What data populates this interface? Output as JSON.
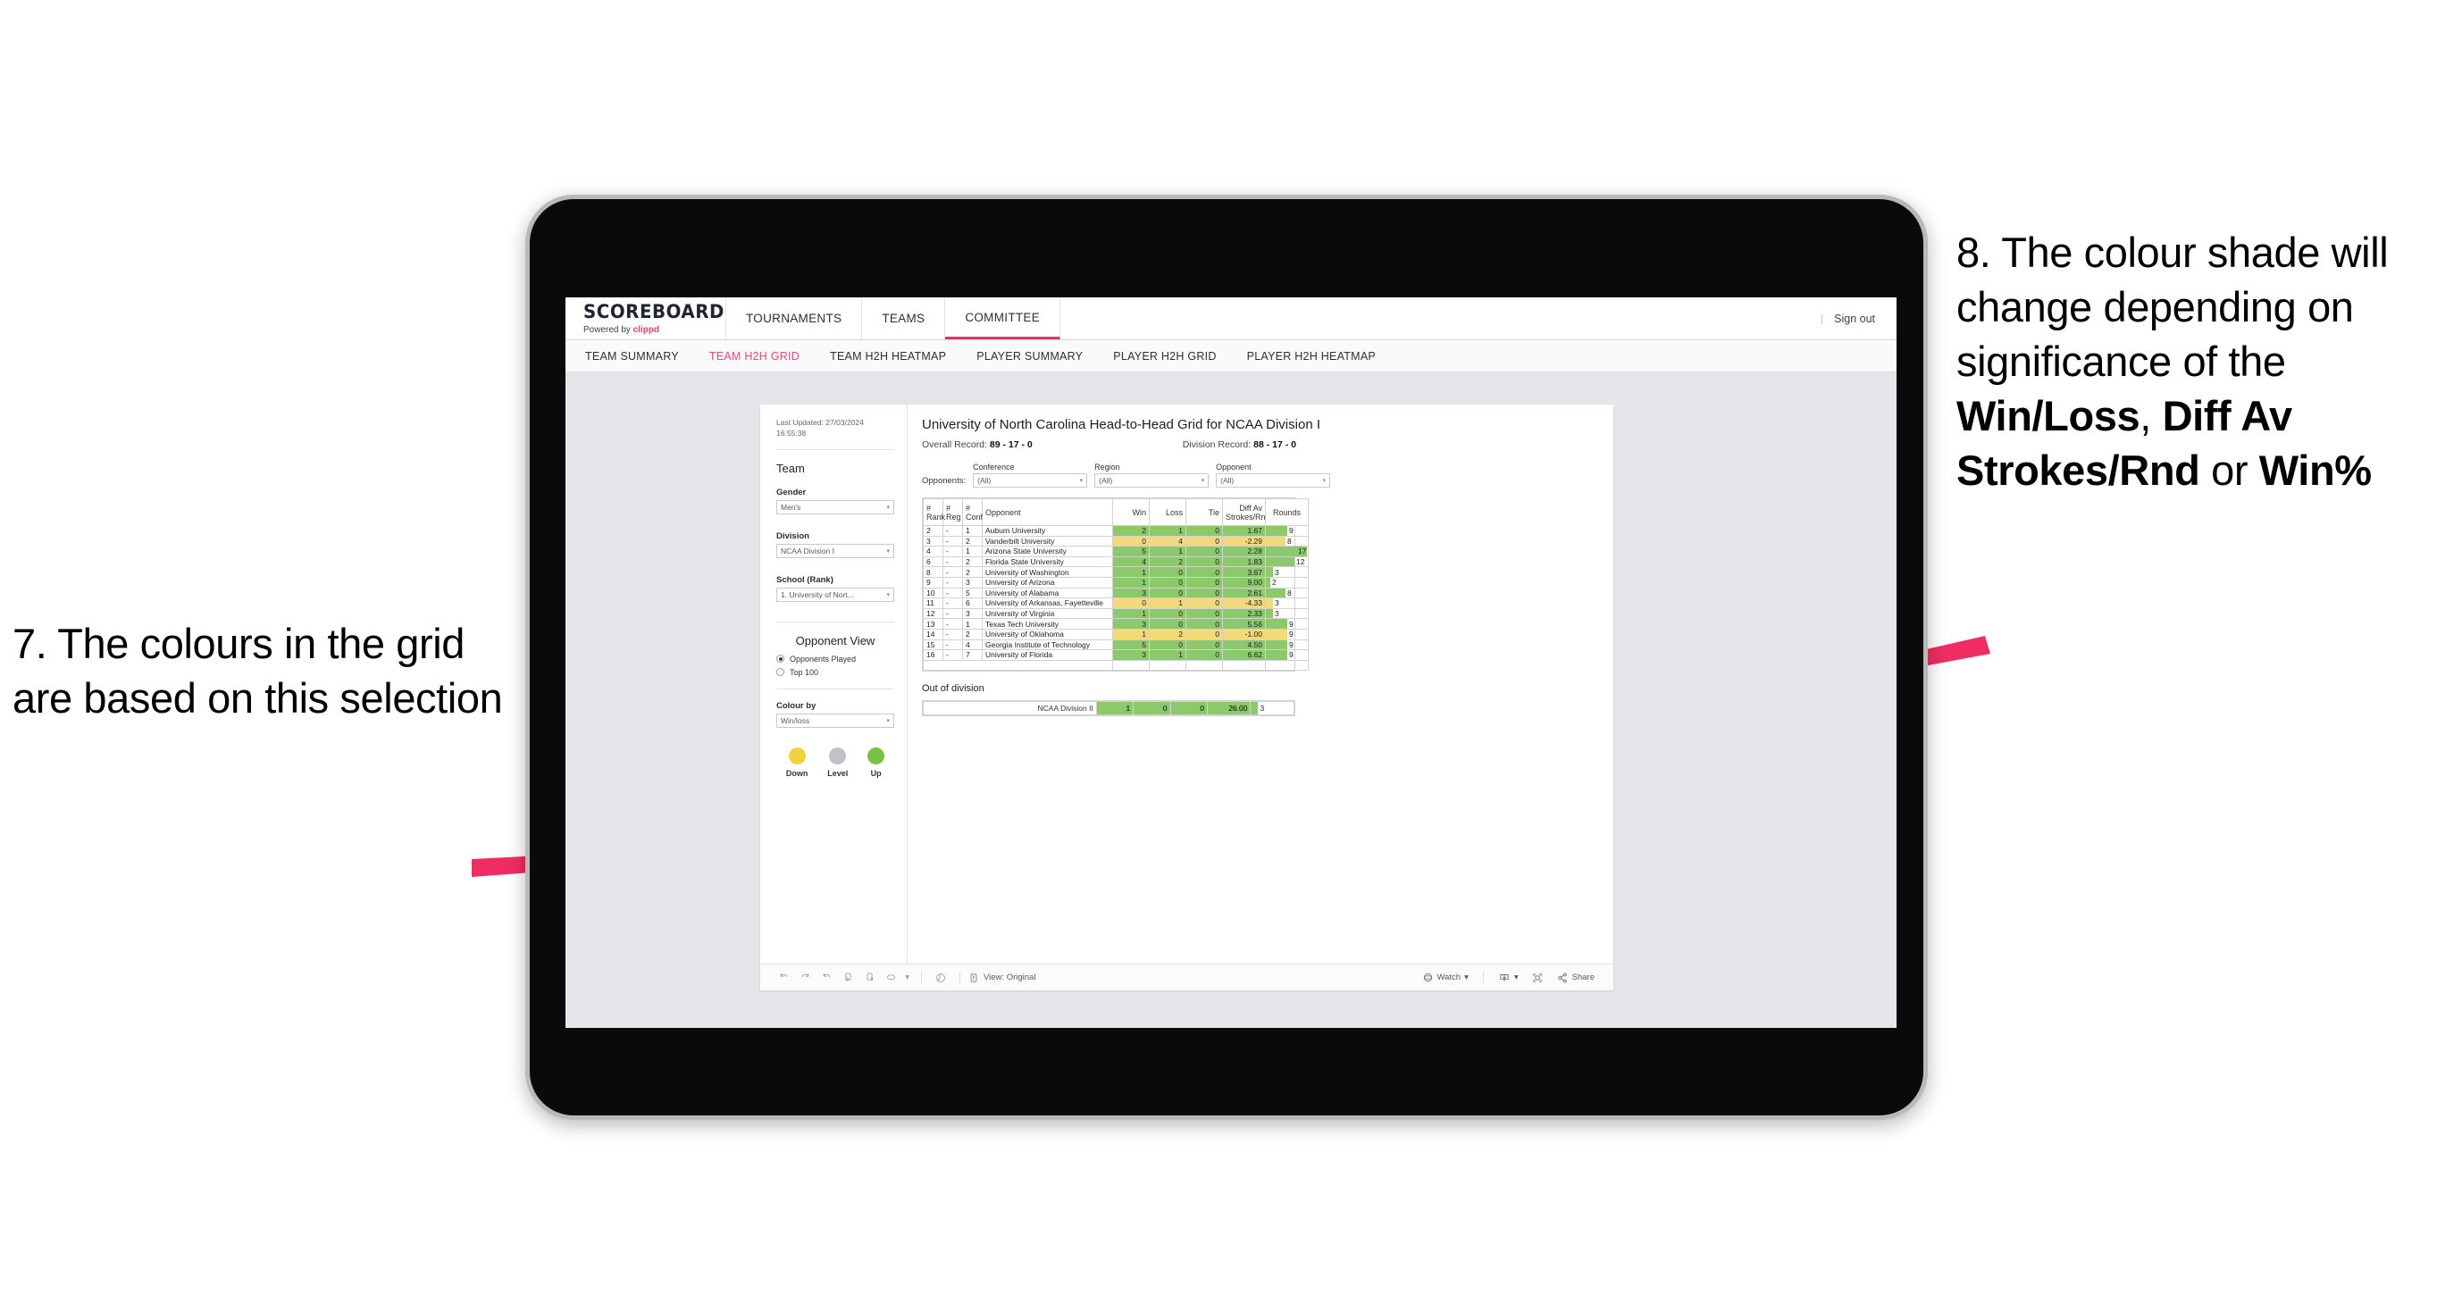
{
  "annotations": {
    "left": {
      "number": "7.",
      "text": "7. The colours in the grid are based on this selection"
    },
    "right": {
      "prefix": "8. The colour shade will change depending on significance of the ",
      "bold1": "Win/Loss",
      "mid1": ", ",
      "bold2": "Diff Av Strokes/Rnd",
      "mid2": " or ",
      "bold3": "Win%"
    },
    "arrow_color": "#ef2d62"
  },
  "app": {
    "brand": {
      "title": "SCOREBOARD",
      "powered_prefix": "Powered by ",
      "powered_brand": "clippd"
    },
    "topnav": [
      {
        "label": "TOURNAMENTS",
        "active": false
      },
      {
        "label": "TEAMS",
        "active": false
      },
      {
        "label": "COMMITTEE",
        "active": true
      }
    ],
    "signout": "Sign out",
    "divider": "|",
    "subnav": [
      {
        "label": "TEAM SUMMARY",
        "active": false
      },
      {
        "label": "TEAM H2H GRID",
        "active": true
      },
      {
        "label": "TEAM H2H HEATMAP",
        "active": false
      },
      {
        "label": "PLAYER SUMMARY",
        "active": false
      },
      {
        "label": "PLAYER H2H GRID",
        "active": false
      },
      {
        "label": "PLAYER H2H HEATMAP",
        "active": false
      }
    ],
    "accent_pink": "#e8477a"
  },
  "filters": {
    "last_updated": "Last Updated: 27/03/2024 16:55:38",
    "team_heading": "Team",
    "gender_label": "Gender",
    "gender_value": "Men's",
    "division_label": "Division",
    "division_value": "NCAA Division I",
    "school_label": "School (Rank)",
    "school_value": "1. University of Nort...",
    "opponent_view_heading": "Opponent View",
    "opponent_view_options": [
      {
        "label": "Opponents Played",
        "selected": true
      },
      {
        "label": "Top 100",
        "selected": false
      }
    ],
    "colour_by_label": "Colour by",
    "colour_by_value": "Win/loss",
    "legend": [
      {
        "label": "Down",
        "color": "#f2d13f"
      },
      {
        "label": "Level",
        "color": "#bfc1c4"
      },
      {
        "label": "Up",
        "color": "#7ac143"
      }
    ]
  },
  "viz": {
    "title": "University of North Carolina Head-to-Head Grid for NCAA Division I",
    "overall_record_label": "Overall Record: ",
    "overall_record_value": "89 - 17 - 0",
    "division_record_label": "Division Record: ",
    "division_record_value": "88 - 17 - 0",
    "opponents_label": "Opponents:",
    "opponent_filters": [
      {
        "label": "Conference",
        "value": "(All)"
      },
      {
        "label": "Region",
        "value": "(All)"
      },
      {
        "label": "Opponent",
        "value": "(All)"
      }
    ],
    "out_of_division_title": "Out of division"
  },
  "chart_data": {
    "type": "table",
    "title": "University of North Carolina Head-to-Head Grid for NCAA Division I",
    "columns": [
      "# Rank",
      "# Reg",
      "# Conf",
      "Opponent",
      "Win",
      "Loss",
      "Tie",
      "Diff Av Strokes/Rnd",
      "Rounds"
    ],
    "rounds_max": 17,
    "colors": {
      "up": "#8cc96a",
      "down": "#f2d97a",
      "level": "#bfc1c4"
    },
    "rows": [
      {
        "rank": "2",
        "reg": "-",
        "conf": "1",
        "opponent": "Auburn University",
        "win": "2",
        "loss": "1",
        "tie": "0",
        "diff": "1.67",
        "rounds": "9",
        "rounds_n": 9,
        "shade": "up"
      },
      {
        "rank": "3",
        "reg": "-",
        "conf": "2",
        "opponent": "Vanderbilt University",
        "win": "0",
        "loss": "4",
        "tie": "0",
        "diff": "-2.29",
        "rounds": "8",
        "rounds_n": 8,
        "shade": "down"
      },
      {
        "rank": "4",
        "reg": "-",
        "conf": "1",
        "opponent": "Arizona State University",
        "win": "5",
        "loss": "1",
        "tie": "0",
        "diff": "2.28",
        "rounds": "17",
        "rounds_n": 17,
        "shade": "up"
      },
      {
        "rank": "6",
        "reg": "-",
        "conf": "2",
        "opponent": "Florida State University",
        "win": "4",
        "loss": "2",
        "tie": "0",
        "diff": "1.83",
        "rounds": "12",
        "rounds_n": 12,
        "shade": "up"
      },
      {
        "rank": "8",
        "reg": "-",
        "conf": "2",
        "opponent": "University of Washington",
        "win": "1",
        "loss": "0",
        "tie": "0",
        "diff": "3.67",
        "rounds": "3",
        "rounds_n": 3,
        "shade": "up"
      },
      {
        "rank": "9",
        "reg": "-",
        "conf": "3",
        "opponent": "University of Arizona",
        "win": "1",
        "loss": "0",
        "tie": "0",
        "diff": "9.00",
        "rounds": "2",
        "rounds_n": 2,
        "shade": "up"
      },
      {
        "rank": "10",
        "reg": "-",
        "conf": "5",
        "opponent": "University of Alabama",
        "win": "3",
        "loss": "0",
        "tie": "0",
        "diff": "2.61",
        "rounds": "8",
        "rounds_n": 8,
        "shade": "up"
      },
      {
        "rank": "11",
        "reg": "-",
        "conf": "6",
        "opponent": "University of Arkansas, Fayetteville",
        "win": "0",
        "loss": "1",
        "tie": "0",
        "diff": "-4.33",
        "rounds": "3",
        "rounds_n": 3,
        "shade": "down"
      },
      {
        "rank": "12",
        "reg": "-",
        "conf": "3",
        "opponent": "University of Virginia",
        "win": "1",
        "loss": "0",
        "tie": "0",
        "diff": "2.33",
        "rounds": "3",
        "rounds_n": 3,
        "shade": "up"
      },
      {
        "rank": "13",
        "reg": "-",
        "conf": "1",
        "opponent": "Texas Tech University",
        "win": "3",
        "loss": "0",
        "tie": "0",
        "diff": "5.56",
        "rounds": "9",
        "rounds_n": 9,
        "shade": "up"
      },
      {
        "rank": "14",
        "reg": "-",
        "conf": "2",
        "opponent": "University of Oklahoma",
        "win": "1",
        "loss": "2",
        "tie": "0",
        "diff": "-1.00",
        "rounds": "9",
        "rounds_n": 9,
        "shade": "down"
      },
      {
        "rank": "15",
        "reg": "-",
        "conf": "4",
        "opponent": "Georgia Institute of Technology",
        "win": "5",
        "loss": "0",
        "tie": "0",
        "diff": "4.50",
        "rounds": "9",
        "rounds_n": 9,
        "shade": "up"
      },
      {
        "rank": "16",
        "reg": "-",
        "conf": "7",
        "opponent": "University of Florida",
        "win": "3",
        "loss": "1",
        "tie": "0",
        "diff": "6.62",
        "rounds": "9",
        "rounds_n": 9,
        "shade": "up"
      }
    ],
    "out_of_division": [
      {
        "name": "NCAA Division II",
        "win": "1",
        "loss": "0",
        "tie": "0",
        "diff": "26.00",
        "rounds": "3",
        "rounds_n": 3,
        "shade": "up"
      }
    ]
  },
  "toolbar": {
    "view_label": "View: Original",
    "watch_label": "Watch",
    "share_label": "Share",
    "caret": "▾"
  }
}
